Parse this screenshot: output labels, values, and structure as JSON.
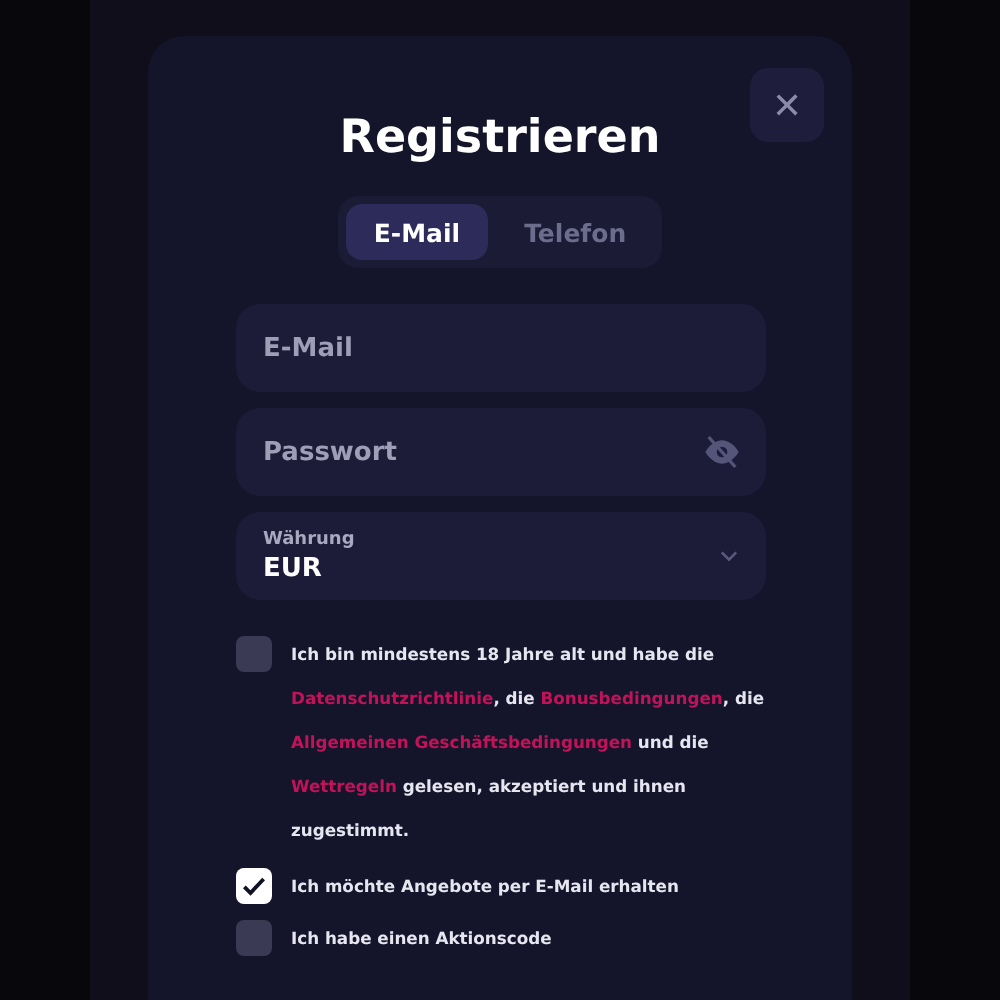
{
  "dialog": {
    "title": "Registrieren",
    "close_icon": "✕"
  },
  "tabs": [
    {
      "label": "E-Mail",
      "selected": true
    },
    {
      "label": "Telefon",
      "selected": false
    }
  ],
  "fields": [
    {
      "kind": "text",
      "placeholder": "E-Mail"
    },
    {
      "kind": "password",
      "placeholder": "Passwort"
    },
    {
      "kind": "select",
      "label": "Währung",
      "value": "EUR"
    }
  ],
  "checkboxes": [
    {
      "checked": false,
      "parts": [
        {
          "kind": "text",
          "text": "Ich bin mindestens 18 Jahre alt und habe die "
        },
        {
          "kind": "link",
          "text": "Datenschutzrichtlinie"
        },
        {
          "kind": "text",
          "text": ", die "
        },
        {
          "kind": "link",
          "text": "Bonusbedingungen"
        },
        {
          "kind": "text",
          "text": ", die "
        },
        {
          "kind": "link",
          "text": "Allgemeinen Geschäftsbedingungen"
        },
        {
          "kind": "text",
          "text": " und die "
        },
        {
          "kind": "link",
          "text": "Wettregeln"
        },
        {
          "kind": "text",
          "text": " gelesen, akzeptiert und ihnen zugestimmt."
        }
      ]
    },
    {
      "checked": true,
      "parts": [
        {
          "kind": "text",
          "text": "Ich möchte Angebote per E-Mail erhalten"
        }
      ]
    },
    {
      "checked": false,
      "parts": [
        {
          "kind": "text",
          "text": "Ich habe einen Aktionscode"
        }
      ]
    }
  ]
}
